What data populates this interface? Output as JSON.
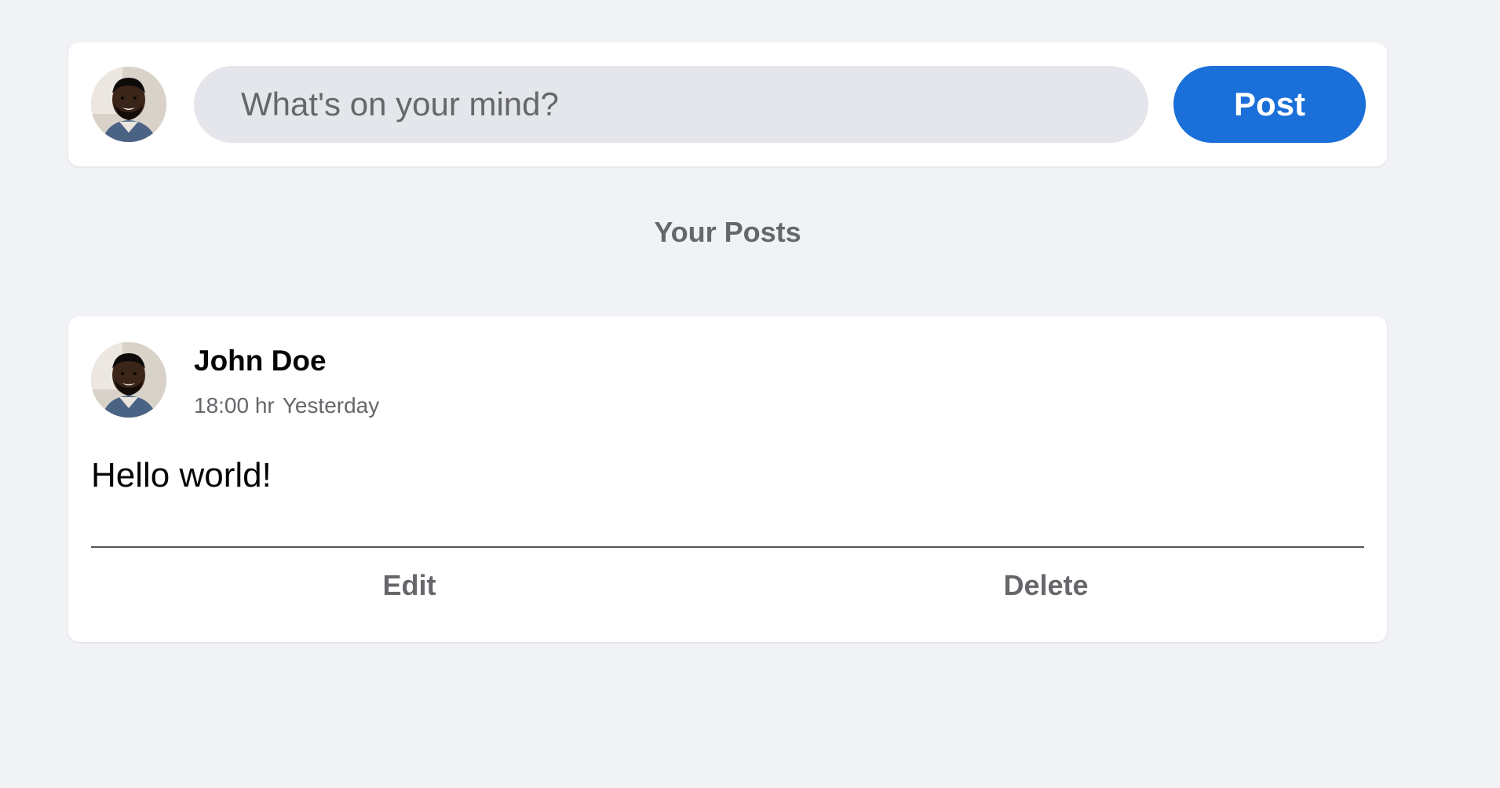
{
  "accent_color": "#1b6fd9",
  "composer": {
    "avatar_icon": "user-avatar-photo",
    "placeholder": "What's on your mind?",
    "value": "",
    "post_label": "Post"
  },
  "section_heading": "Your Posts",
  "posts": [
    {
      "avatar_icon": "user-avatar-photo",
      "author": "John Doe",
      "time": "18:00 hr",
      "day": "Yesterday",
      "text": "Hello world!",
      "edit_label": "Edit",
      "delete_label": "Delete"
    }
  ]
}
